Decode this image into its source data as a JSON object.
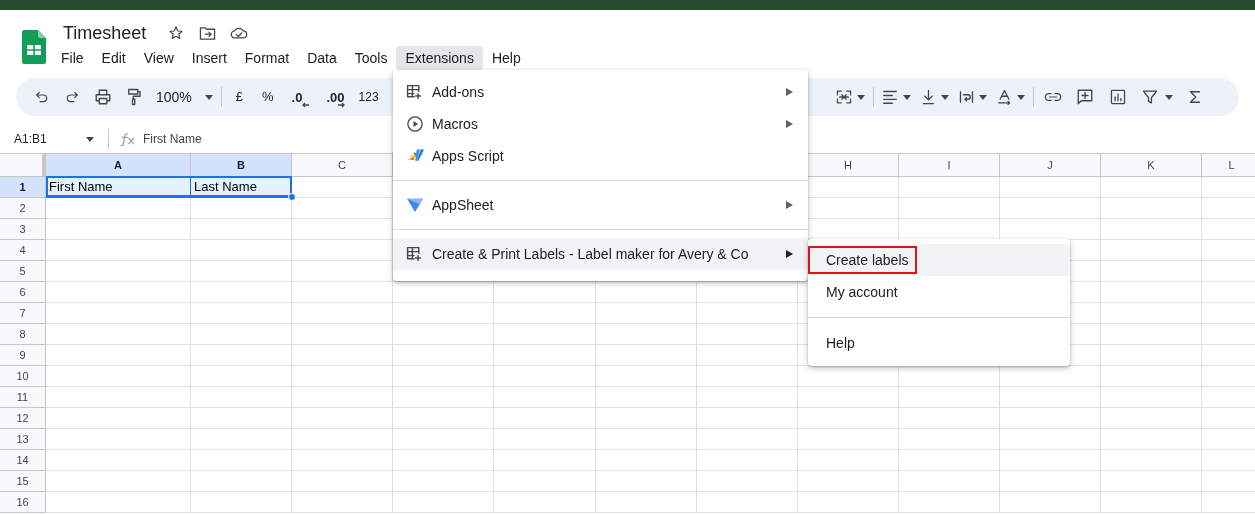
{
  "document": {
    "title": "Timesheet"
  },
  "menu_bar": [
    {
      "label": "File",
      "selected": false
    },
    {
      "label": "Edit",
      "selected": false
    },
    {
      "label": "View",
      "selected": false
    },
    {
      "label": "Insert",
      "selected": false
    },
    {
      "label": "Format",
      "selected": false
    },
    {
      "label": "Data",
      "selected": false
    },
    {
      "label": "Tools",
      "selected": false
    },
    {
      "label": "Extensions",
      "selected": true
    },
    {
      "label": "Help",
      "selected": false
    }
  ],
  "toolbar": {
    "zoom": "100%",
    "currency": "£",
    "percent": "%",
    "decrease_decimal": ".0",
    "increase_decimal": ".00",
    "number_format": "123"
  },
  "formula_bar": {
    "name_box": "A1:B1",
    "formula": "First Name"
  },
  "grid": {
    "columns": [
      {
        "label": "A",
        "selected": true
      },
      {
        "label": "B",
        "selected": true
      },
      {
        "label": "C",
        "selected": false
      },
      {
        "label": "H",
        "selected": false
      },
      {
        "label": "I",
        "selected": false
      },
      {
        "label": "J",
        "selected": false
      },
      {
        "label": "K",
        "selected": false
      },
      {
        "label": "L",
        "selected": false
      }
    ],
    "rows": [
      {
        "label": "1",
        "selected": true,
        "cells": [
          {
            "text": "First Name",
            "selected": true
          },
          {
            "text": "Last Name",
            "selected": true
          }
        ]
      },
      {
        "label": "2",
        "selected": false
      },
      {
        "label": "3",
        "selected": false
      },
      {
        "label": "4",
        "selected": false
      },
      {
        "label": "5",
        "selected": false
      },
      {
        "label": "6",
        "selected": false
      },
      {
        "label": "7",
        "selected": false
      },
      {
        "label": "8",
        "selected": false
      },
      {
        "label": "9",
        "selected": false
      },
      {
        "label": "10",
        "selected": false
      },
      {
        "label": "11",
        "selected": false
      },
      {
        "label": "12",
        "selected": false
      },
      {
        "label": "13",
        "selected": false
      },
      {
        "label": "14",
        "selected": false
      },
      {
        "label": "15",
        "selected": false
      },
      {
        "label": "16",
        "selected": false
      }
    ]
  },
  "extensions_menu": {
    "items": [
      {
        "kind": "item",
        "label": "Add-ons",
        "submenu": true,
        "highlighted": false
      },
      {
        "kind": "item",
        "label": "Macros",
        "submenu": true,
        "highlighted": false
      },
      {
        "kind": "item",
        "label": "Apps Script",
        "submenu": false,
        "highlighted": false
      },
      {
        "kind": "divider"
      },
      {
        "kind": "item",
        "label": "AppSheet",
        "submenu": true,
        "highlighted": false
      },
      {
        "kind": "divider"
      },
      {
        "kind": "item",
        "label": "Create & Print Labels - Label maker for Avery & Co",
        "submenu": true,
        "highlighted": true
      }
    ]
  },
  "labels_submenu": {
    "items": [
      {
        "kind": "item",
        "label": "Create labels",
        "highlighted": true,
        "annotated": true
      },
      {
        "kind": "item",
        "label": "My account",
        "highlighted": false,
        "annotated": false
      },
      {
        "kind": "divider"
      },
      {
        "kind": "item",
        "label": "Help",
        "highlighted": false,
        "annotated": false
      }
    ]
  }
}
